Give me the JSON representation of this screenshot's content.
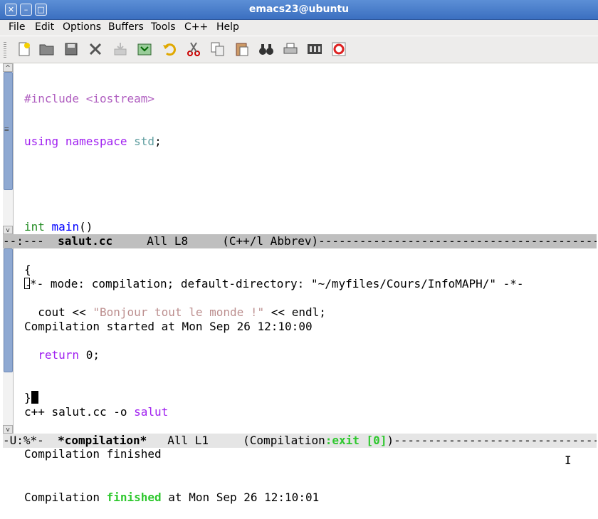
{
  "window": {
    "title": "emacs23@ubuntu"
  },
  "menu": [
    "File",
    "Edit",
    "Options",
    "Buffers",
    "Tools",
    "C++",
    "Help"
  ],
  "toolbar": {
    "icons": [
      "new-file-icon",
      "open-folder-icon",
      "save-disk-icon",
      "close-x-icon",
      "insert-icon",
      "save-as-icon",
      "undo-icon",
      "cut-scissors-icon",
      "copy-icon",
      "paste-icon",
      "search-binoculars-icon",
      "print-icon",
      "preferences-icon",
      "help-lifebuoy-icon"
    ]
  },
  "editor": {
    "l1_pre": "#include <iostream>",
    "l2_using": "using",
    "l2_ns": "namespace",
    "l2_std": "std",
    "l2_semi": ";",
    "l4_int": "int",
    "l4_main": "main",
    "l4_paren": "()",
    "l5_brace": "{",
    "l6_cout": "  cout << ",
    "l6_str": "\"Bonjour tout le monde !\"",
    "l6_end": " << endl;",
    "l7_ret": "return",
    "l7_rest": " 0;",
    "l8_brace": "}"
  },
  "modeline_top": {
    "status": "--:---  ",
    "buffer": "salut.cc",
    "position": "     All L8     ",
    "mode": "(C++/l Abbrev)",
    "fill": "-----------------------------------------------"
  },
  "compilation": {
    "header": "*- mode: compilation; default-directory: \"~/myfiles/Cours/InfoMAPH/\" -*-",
    "header_dash": "-",
    "started": "Compilation started at Mon Sep 26 12:10:00",
    "cmd_prefix": "c++ salut.cc -o ",
    "cmd_target": "salut",
    "finished_prefix": "Compilation ",
    "finished_word": "finished",
    "finished_suffix": " at Mon Sep 26 12:10:01"
  },
  "modeline_bottom": {
    "status": "-U:%*-  ",
    "buffer": "*compilation*",
    "position": "   All L1     ",
    "mode_open": "(Compilation",
    "mode_exit": ":exit [0]",
    "mode_close": ")",
    "fill": "---------------------------------------"
  },
  "echo_area": "Compilation finished",
  "colors": {
    "titlebar": "#3b6fc0",
    "scroll_thumb": "#8fa9d2",
    "keyword": "#a020f0",
    "string": "#bc8f8f",
    "success": "#2ec82e"
  }
}
